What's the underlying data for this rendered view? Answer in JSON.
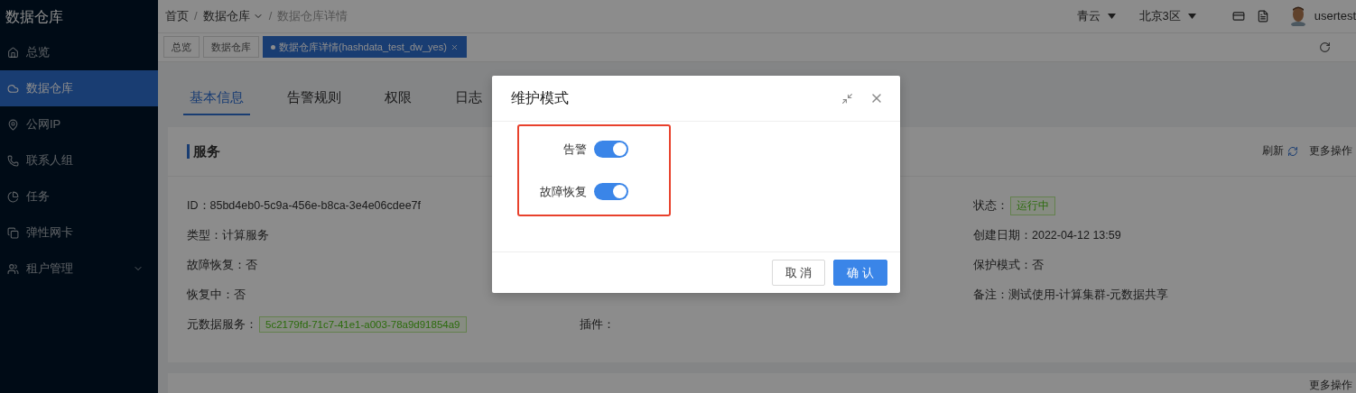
{
  "sidebar": {
    "title": "数据仓库",
    "items": [
      {
        "label": "总览",
        "selected": false
      },
      {
        "label": "数据仓库",
        "selected": true
      },
      {
        "label": "公网IP",
        "selected": false
      },
      {
        "label": "联系人组",
        "selected": false
      },
      {
        "label": "任务",
        "selected": false
      },
      {
        "label": "弹性网卡",
        "selected": false
      },
      {
        "label": "租户管理",
        "selected": false,
        "expandable": true
      }
    ]
  },
  "breadcrumb": {
    "separator": "/",
    "items": [
      {
        "label": "首页"
      },
      {
        "label": "数据仓库",
        "dropdown": true
      },
      {
        "label": "数据仓库详情"
      }
    ]
  },
  "header": {
    "cloud": "青云",
    "region": "北京3区",
    "user": "usertest"
  },
  "page_tabs": [
    {
      "label": "总览",
      "selected": false
    },
    {
      "label": "数据仓库",
      "selected": false
    },
    {
      "label": "数据仓库详情(hashdata_test_dw_yes)",
      "selected": true,
      "closable": true
    }
  ],
  "section_tabs": [
    {
      "label": "基本信息",
      "selected": true
    },
    {
      "label": "告警规则",
      "selected": false
    },
    {
      "label": "权限",
      "selected": false
    },
    {
      "label": "日志",
      "selected": false
    }
  ],
  "service_card": {
    "title": "服务",
    "refresh": "刷新",
    "more": "更多操作",
    "left": [
      {
        "kind": "text",
        "text": "ID：85bd4eb0-5c9a-456e-b8ca-3e4e06cdee7f"
      },
      {
        "kind": "text",
        "text": "类型：计算服务"
      },
      {
        "kind": "text",
        "text": "故障恢复：否"
      },
      {
        "kind": "text",
        "text": "恢复中：否"
      },
      {
        "kind": "tag",
        "text": "元数据服务：",
        "tag": "5c2179fd-71c7-41e1-a003-78a9d91854a9"
      }
    ],
    "middle": [
      {
        "text": "插件："
      }
    ],
    "right": [
      {
        "kind": "tag",
        "text": "状态：",
        "tag": "运行中"
      },
      {
        "kind": "text",
        "text": "创建日期：2022-04-12 13:59"
      },
      {
        "kind": "text",
        "text": "保护模式：否"
      },
      {
        "kind": "text",
        "text": "备注：测试使用-计算集群-元数据共享"
      }
    ]
  },
  "second_card": {
    "more": "更多操作"
  },
  "dialog": {
    "title": "维护模式",
    "switches": [
      {
        "label": "告警",
        "on": true
      },
      {
        "label": "故障恢复",
        "on": true
      }
    ],
    "buttons": [
      {
        "label": "取 消",
        "kind": "default"
      },
      {
        "label": "确 认",
        "kind": "primary"
      }
    ]
  }
}
